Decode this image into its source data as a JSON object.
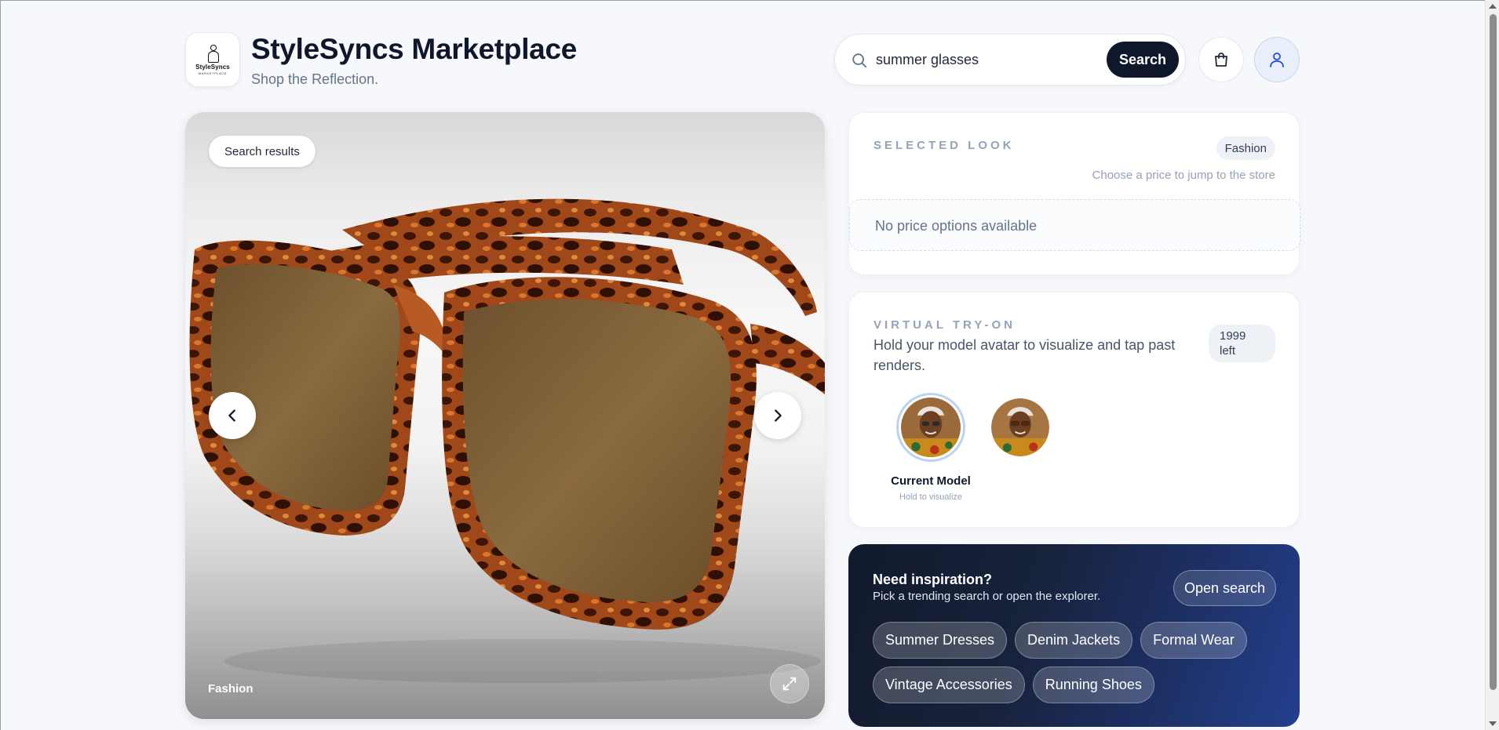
{
  "header": {
    "logo_text": "StyleSyncs",
    "logo_subtext": "MARKETPLACE",
    "title": "StyleSyncs Marketplace",
    "tagline": "Shop the Reflection.",
    "search": {
      "value": "summer glasses",
      "placeholder": "",
      "button_label": "Search"
    },
    "icons": [
      "search-icon",
      "cart-icon",
      "user-icon"
    ]
  },
  "hero": {
    "chip_label": "Search results",
    "caption": "Fashion",
    "icons": [
      "chevron-left-icon",
      "chevron-right-icon",
      "expand-icon"
    ]
  },
  "selected_look": {
    "eyebrow": "SELECTED LOOK",
    "category": "Fashion",
    "hint": "Choose a price to jump to the store",
    "empty_message": "No price options available"
  },
  "virtual_tryon": {
    "eyebrow": "VIRTUAL TRY-ON",
    "description": "Hold your model avatar to visualize and tap past renders.",
    "remaining": "1999 left",
    "current_label": "Current Model",
    "current_hint": "Hold to visualize"
  },
  "inspiration": {
    "title": "Need inspiration?",
    "subtitle": "Pick a trending search or open the explorer.",
    "open_button": "Open search",
    "chips": [
      "Summer Dresses",
      "Denim Jackets",
      "Formal Wear",
      "Vintage Accessories",
      "Running Shoes"
    ]
  },
  "colors": {
    "primary_dark": "#0f172a",
    "muted_text": "#64748b",
    "eyebrow_text": "#94a3b8",
    "inspiration_start": "#121a2c",
    "inspiration_end": "#243f8e",
    "frame_tortoise": "#8a3d14",
    "lens_brown": "#7a5a34"
  }
}
